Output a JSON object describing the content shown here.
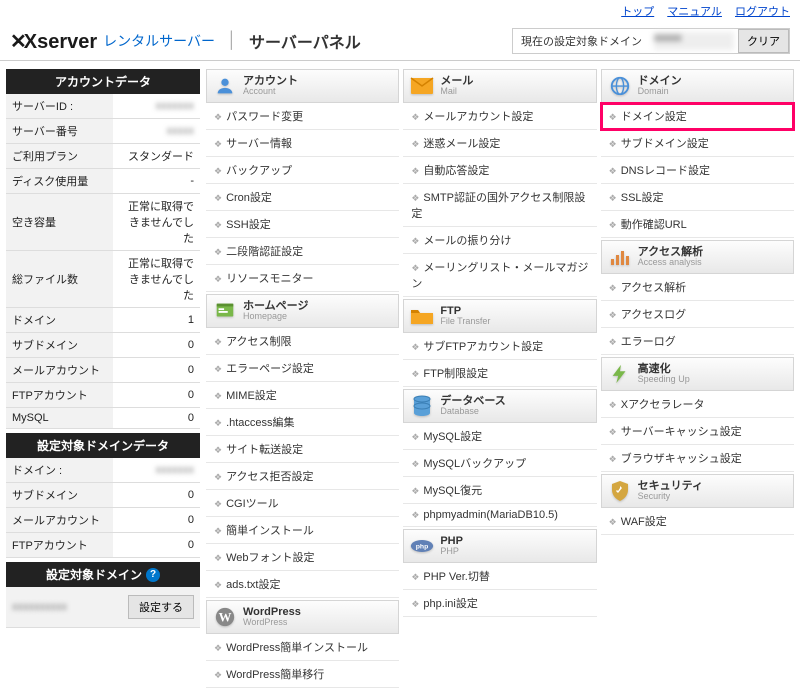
{
  "topnav": {
    "top": "トップ",
    "manual": "マニュアル",
    "logout": "ログアウト"
  },
  "header": {
    "logo_brand": "Xserver",
    "logo_sub": "レンタルサーバー",
    "panel_title": "サーバーパネル",
    "domain_label": "現在の設定対象ドメイン",
    "clear": "クリア"
  },
  "sidebar": {
    "acct_hdr": "アカウントデータ",
    "rows": [
      {
        "k": "サーバーID :",
        "v": "xxxxxxx",
        "blur": true
      },
      {
        "k": "サーバー番号",
        "v": "xxxxx",
        "blur": true
      },
      {
        "k": "ご利用プラン",
        "v": "スタンダード"
      },
      {
        "k": "ディスク使用量",
        "v": "-"
      },
      {
        "k": "空き容量",
        "v": "正常に取得できませんでした"
      },
      {
        "k": "総ファイル数",
        "v": "正常に取得できませんでした"
      },
      {
        "k": "ドメイン",
        "v": "1"
      },
      {
        "k": "サブドメイン",
        "v": "0"
      },
      {
        "k": "メールアカウント",
        "v": "0"
      },
      {
        "k": "FTPアカウント",
        "v": "0"
      },
      {
        "k": "MySQL",
        "v": "0"
      }
    ],
    "targ_hdr": "設定対象ドメインデータ",
    "trows": [
      {
        "k": "ドメイン :",
        "v": "xxxxxxx",
        "blur": true
      },
      {
        "k": "サブドメイン",
        "v": "0"
      },
      {
        "k": "メールアカウント",
        "v": "0"
      },
      {
        "k": "FTPアカウント",
        "v": "0"
      }
    ],
    "setdom_hdr": "設定対象ドメイン",
    "setbtn": "設定する"
  },
  "cats": {
    "c1": [
      {
        "title": "アカウント",
        "sub": "Account",
        "icon": "account",
        "items": [
          "パスワード変更",
          "サーバー情報",
          "バックアップ",
          "Cron設定",
          "SSH設定",
          "二段階認証設定",
          "リソースモニター"
        ]
      },
      {
        "title": "ホームページ",
        "sub": "Homepage",
        "icon": "homepage",
        "items": [
          "アクセス制限",
          "エラーページ設定",
          "MIME設定",
          ".htaccess編集",
          "サイト転送設定",
          "アクセス拒否設定",
          "CGIツール",
          "簡単インストール",
          "Webフォント設定",
          "ads.txt設定"
        ]
      },
      {
        "title": "WordPress",
        "sub": "WordPress",
        "icon": "wordpress",
        "items": [
          "WordPress簡単インストール",
          "WordPress簡単移行"
        ]
      }
    ],
    "c2": [
      {
        "title": "メール",
        "sub": "Mail",
        "icon": "mail",
        "items": [
          "メールアカウント設定",
          "迷惑メール設定",
          "自動応答設定",
          "SMTP認証の国外アクセス制限設定",
          "メールの振り分け",
          "メーリングリスト・メールマガジン"
        ]
      },
      {
        "title": "FTP",
        "sub": "File Transfer",
        "icon": "ftp",
        "items": [
          "サブFTPアカウント設定",
          "FTP制限設定"
        ]
      },
      {
        "title": "データベース",
        "sub": "Database",
        "icon": "database",
        "items": [
          "MySQL設定",
          "MySQLバックアップ",
          "MySQL復元",
          "phpmyadmin(MariaDB10.5)"
        ]
      },
      {
        "title": "PHP",
        "sub": "PHP",
        "icon": "php",
        "items": [
          "PHP Ver.切替",
          "php.ini設定"
        ]
      }
    ],
    "c3": [
      {
        "title": "ドメイン",
        "sub": "Domain",
        "icon": "domain",
        "items": [
          {
            "t": "ドメイン設定",
            "hl": true
          },
          "サブドメイン設定",
          "DNSレコード設定",
          "SSL設定",
          "動作確認URL"
        ]
      },
      {
        "title": "アクセス解析",
        "sub": "Access analysis",
        "icon": "access",
        "items": [
          "アクセス解析",
          "アクセスログ",
          "エラーログ"
        ]
      },
      {
        "title": "高速化",
        "sub": "Speeding Up",
        "icon": "speed",
        "items": [
          "Xアクセラレータ",
          "サーバーキャッシュ設定",
          "ブラウザキャッシュ設定"
        ]
      },
      {
        "title": "セキュリティ",
        "sub": "Security",
        "icon": "security",
        "items": [
          "WAF設定"
        ]
      }
    ]
  }
}
